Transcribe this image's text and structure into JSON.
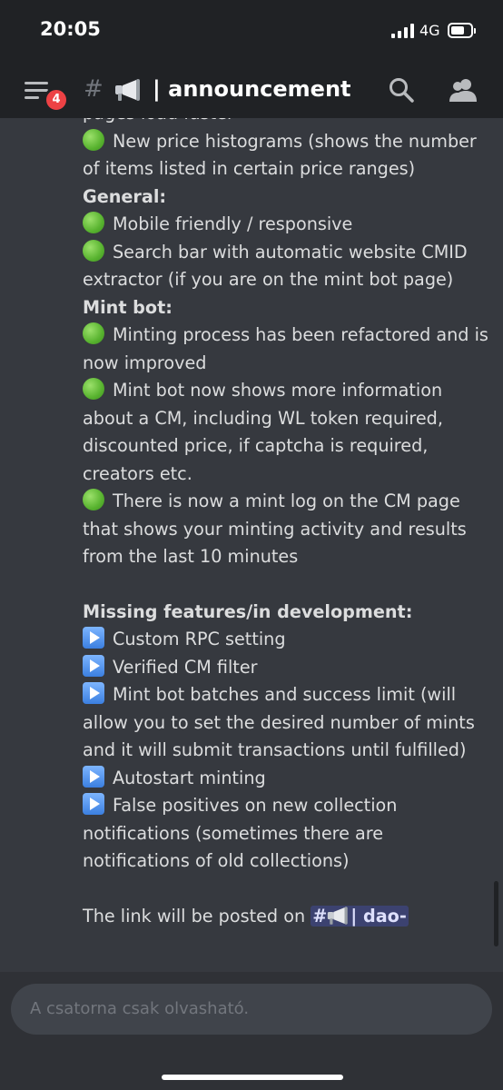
{
  "status": {
    "time": "20:05",
    "network": "4G"
  },
  "header": {
    "badge_count": "4",
    "hash": "#",
    "channel_name": "| announcement"
  },
  "message": {
    "clipped_line": "pages load faster",
    "lines": [
      {
        "type": "item",
        "icon": "green-circle-icon",
        "text": "New price histograms (shows the number"
      },
      {
        "type": "text",
        "text": "of items listed in certain price ranges)"
      },
      {
        "type": "heading",
        "text": "General:"
      },
      {
        "type": "item",
        "icon": "green-circle-icon",
        "text": "Mobile friendly / responsive"
      },
      {
        "type": "item",
        "icon": "green-circle-icon",
        "text": "Search bar with automatic website CMID"
      },
      {
        "type": "text",
        "text": "extractor (if you are on the mint bot page)"
      },
      {
        "type": "heading",
        "text": "Mint bot:"
      },
      {
        "type": "item",
        "icon": "green-circle-icon",
        "text": "Minting process has been refactored and is"
      },
      {
        "type": "text",
        "text": "now improved"
      },
      {
        "type": "item",
        "icon": "green-circle-icon",
        "text": "Mint bot now shows more information"
      },
      {
        "type": "text",
        "text": "about a CM, including WL token required,"
      },
      {
        "type": "text",
        "text": "discounted price, if captcha is required,"
      },
      {
        "type": "text",
        "text": "creators etc."
      },
      {
        "type": "item",
        "icon": "green-circle-icon",
        "text": "There is now a mint log on the CM page"
      },
      {
        "type": "text",
        "text": "that shows your minting activity and results"
      },
      {
        "type": "text",
        "text": "from the last 10 minutes"
      },
      {
        "type": "blank",
        "text": ""
      },
      {
        "type": "heading",
        "text": "Missing features/in development:"
      },
      {
        "type": "item",
        "icon": "play-button-icon",
        "text": "Custom RPC setting"
      },
      {
        "type": "item",
        "icon": "play-button-icon",
        "text": "Verified CM filter"
      },
      {
        "type": "item",
        "icon": "play-button-icon",
        "text": "Mint bot batches and success limit (will"
      },
      {
        "type": "text",
        "text": "allow you to set the desired number of mints"
      },
      {
        "type": "text",
        "text": "and it will submit transactions until fulfilled)"
      },
      {
        "type": "item",
        "icon": "play-button-icon",
        "text": "Autostart minting"
      },
      {
        "type": "item",
        "icon": "play-button-icon",
        "text": "False positives on new collection"
      },
      {
        "type": "text",
        "text": "notifications (sometimes there are"
      },
      {
        "type": "text",
        "text": "notifications of old collections)"
      },
      {
        "type": "blank",
        "text": ""
      }
    ],
    "link_prefix": "The link will be posted on ",
    "mention_hash": "#",
    "mention_channel": "| dao-"
  },
  "footer": {
    "placeholder": "A csatorna csak olvasható."
  },
  "colors": {
    "background": "#36393f",
    "header": "#202225",
    "badge": "#ed4245",
    "mention": "#3c4270"
  }
}
